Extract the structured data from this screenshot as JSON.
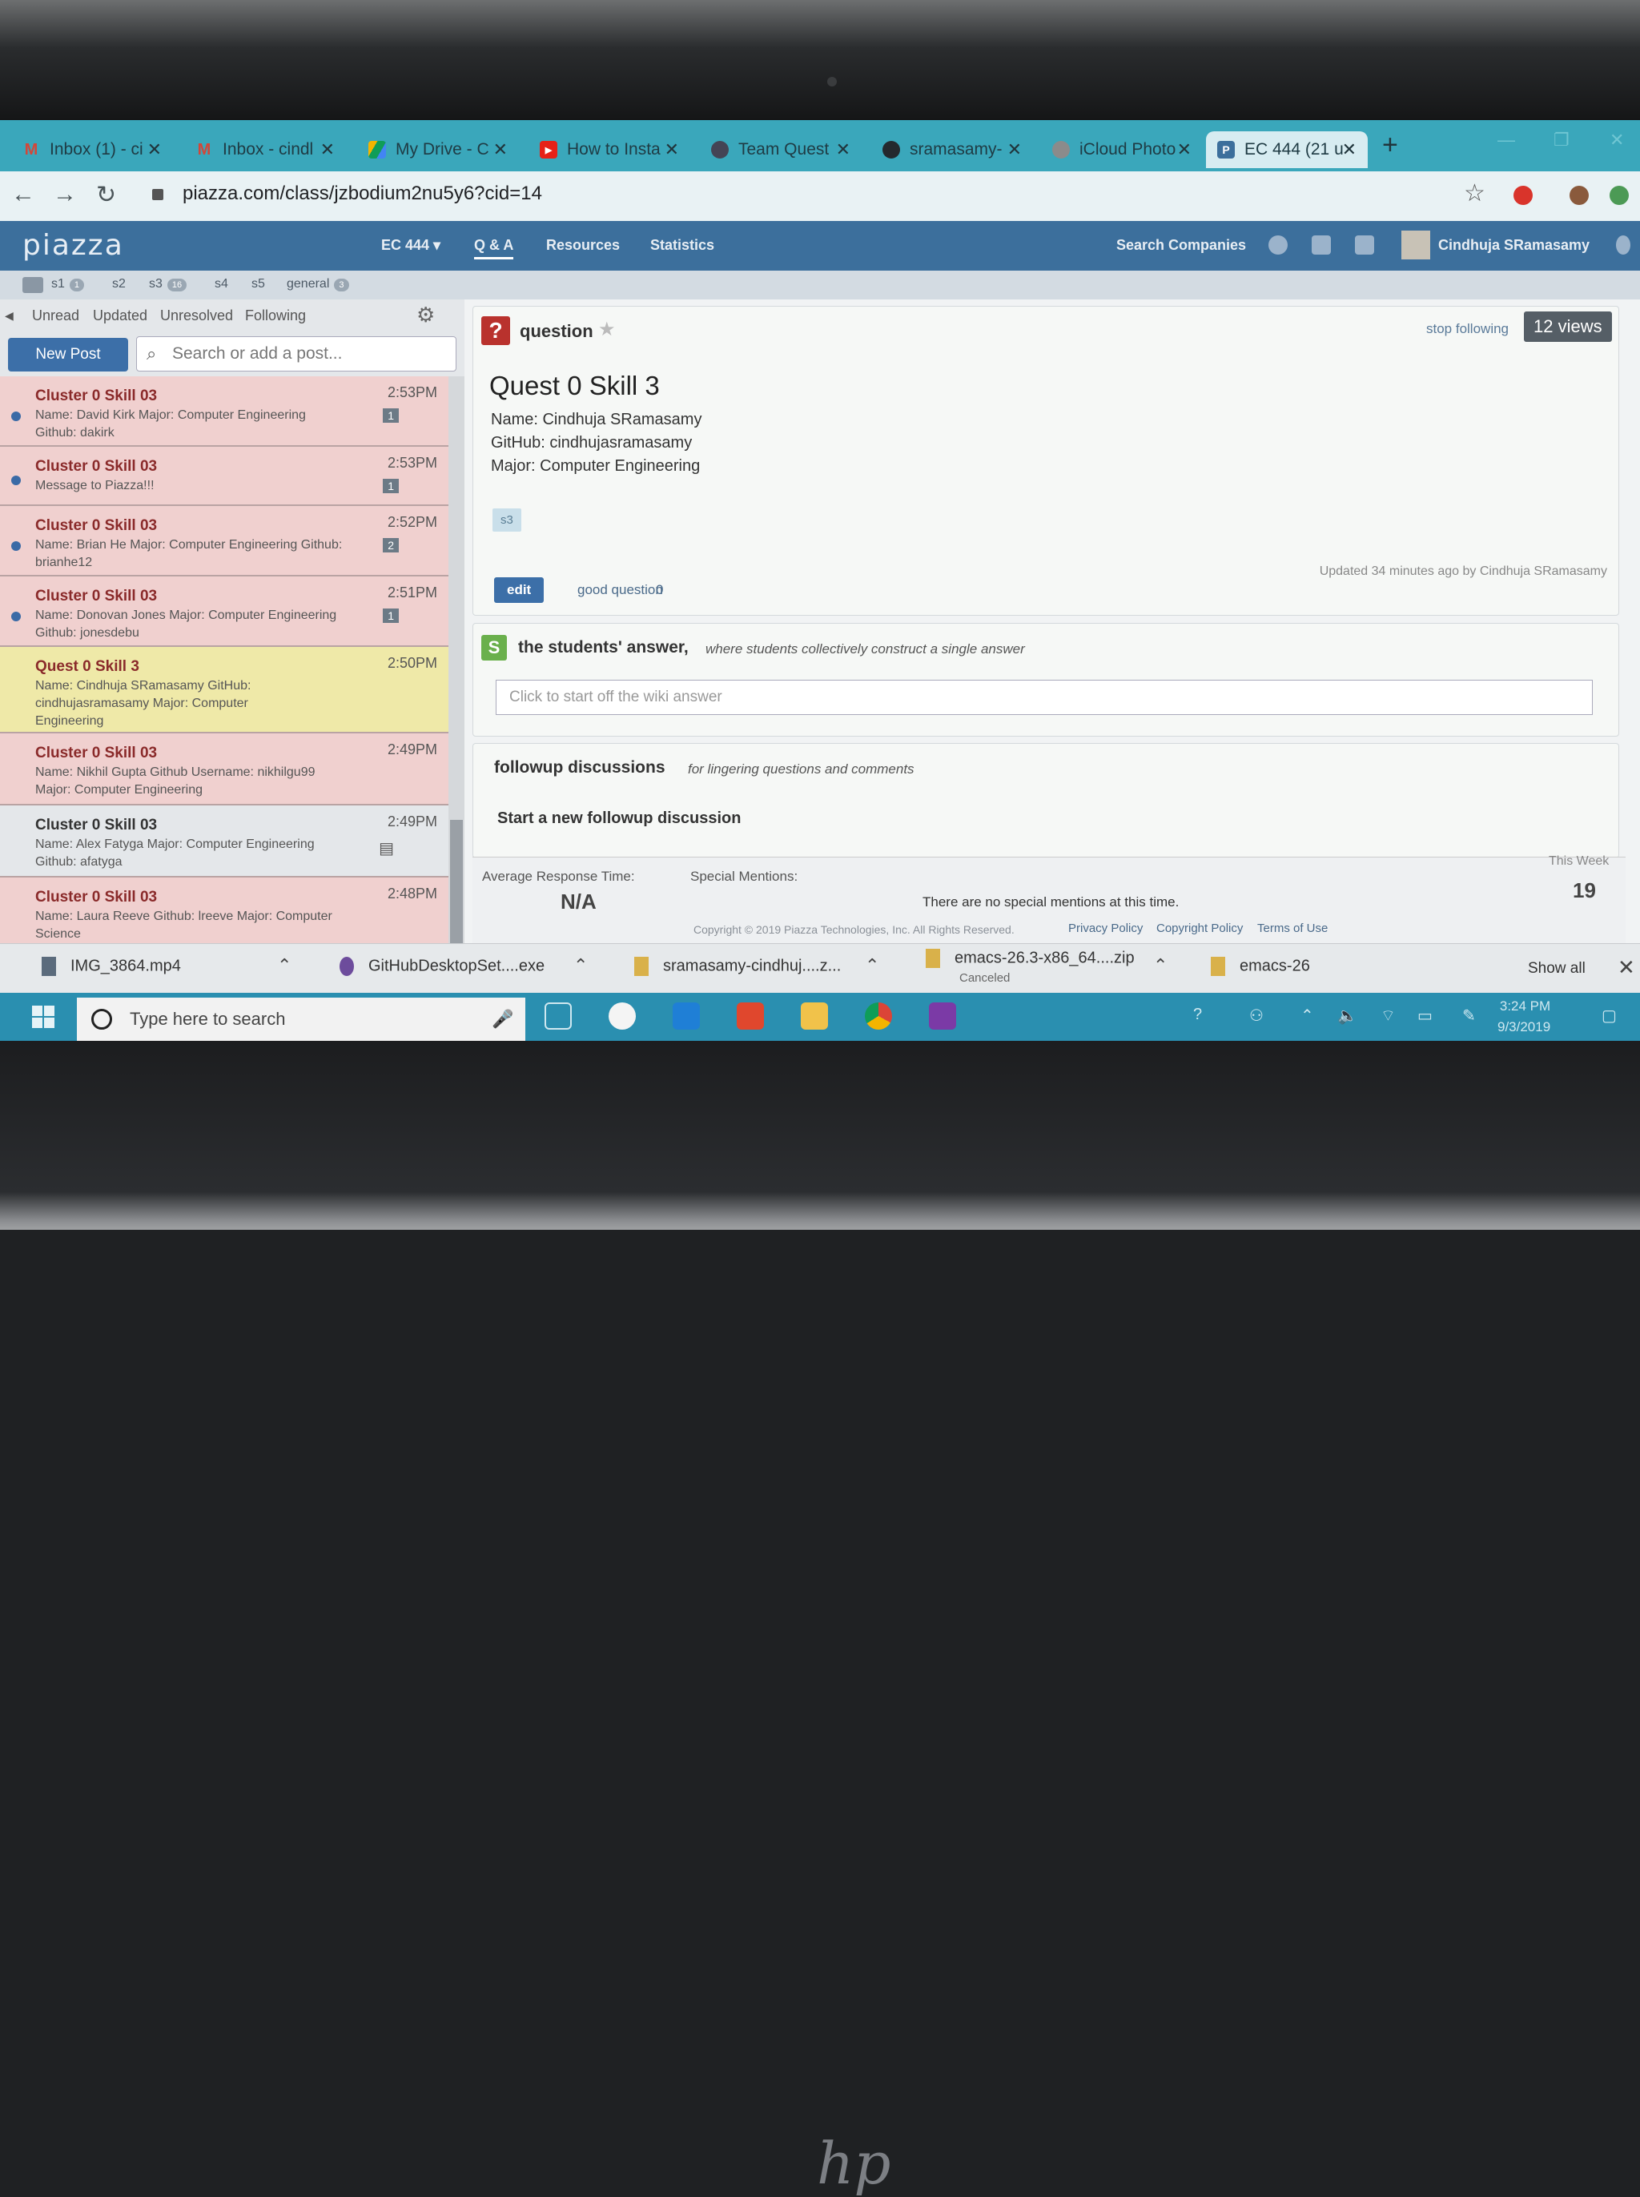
{
  "browser": {
    "tabs": [
      {
        "title": "Inbox (1) - ci",
        "icon": "gmail-icon"
      },
      {
        "title": "Inbox - cindl",
        "icon": "gmail-icon"
      },
      {
        "title": "My Drive - C",
        "icon": "drive-icon"
      },
      {
        "title": "How to Insta",
        "icon": "youtube-icon"
      },
      {
        "title": "Team Quest",
        "icon": "globe-icon"
      },
      {
        "title": "sramasamy-",
        "icon": "github-icon"
      },
      {
        "title": "iCloud Photo",
        "icon": "apple-icon"
      },
      {
        "title": "EC 444 (21 u",
        "icon": "piazza-icon"
      }
    ],
    "url": "piazza.com/class/jzbodium2nu5y6?cid=14"
  },
  "piazza": {
    "logo": "piazza",
    "nav": {
      "course": "EC 444 ▾",
      "qa": "Q & A",
      "resources": "Resources",
      "statistics": "Statistics",
      "search_companies": "Search Companies",
      "user": "Cindhuja SRamasamy"
    },
    "folders": [
      {
        "name": "s1",
        "count": "1"
      },
      {
        "name": "s2",
        "count": ""
      },
      {
        "name": "s3",
        "count": "16"
      },
      {
        "name": "s4",
        "count": ""
      },
      {
        "name": "s5",
        "count": ""
      },
      {
        "name": "general",
        "count": "3"
      }
    ],
    "filters": [
      "Unread",
      "Updated",
      "Unresolved",
      "Following"
    ],
    "new_post": "New Post",
    "search_placeholder": "Search or add a post...",
    "posts": [
      {
        "title": "Cluster 0 Skill 03",
        "time": "2:53PM",
        "body": "Name: David Kirk Major: Computer Engineering Github: dakirk",
        "count": "1",
        "unread": true
      },
      {
        "title": "Cluster 0 Skill 03",
        "time": "2:53PM",
        "body": "Message to Piazza!!!",
        "count": "1",
        "unread": true
      },
      {
        "title": "Cluster 0 Skill 03",
        "time": "2:52PM",
        "body": "Name: Brian He Major: Computer Engineering Github: brianhe12",
        "count": "2",
        "unread": true
      },
      {
        "title": "Cluster 0 Skill 03",
        "time": "2:51PM",
        "body": "Name: Donovan Jones Major: Computer Engineering Github: jonesdebu",
        "count": "1",
        "unread": true
      },
      {
        "title": "Quest 0 Skill 3",
        "time": "2:50PM",
        "body": "Name: Cindhuja SRamasamy GitHub: cindhujasramasamy Major: Computer Engineering",
        "count": "",
        "unread": false
      },
      {
        "title": "Cluster 0 Skill 03",
        "time": "2:49PM",
        "body": "Name: Nikhil Gupta Github Username: nikhilgu99 Major: Computer Engineering",
        "count": "",
        "unread": false
      },
      {
        "title": "Cluster 0 Skill 03",
        "time": "2:49PM",
        "body": "Name: Alex Fatyga Major: Computer Engineering Github: afatyga",
        "count": "",
        "unread": false
      },
      {
        "title": "Cluster 0 Skill 03",
        "time": "2:48PM",
        "body": "Name: Laura Reeve Github: lreeve Major: Computer Science",
        "count": "",
        "unread": false
      }
    ],
    "question": {
      "type": "question",
      "stop_following": "stop following",
      "views": "12 views",
      "title": "Quest 0 Skill 3",
      "lines": [
        "Name: Cindhuja SRamasamy",
        "GitHub: cindhujasramasamy",
        "Major: Computer Engineering"
      ],
      "tag": "s3",
      "edit": "edit",
      "good_question": "good question",
      "good_count": "0",
      "updated": "Updated 34 minutes ago by Cindhuja SRamasamy"
    },
    "students_answer": {
      "icon": "S",
      "heading": "the students' answer,",
      "subheading": "where students collectively construct a single answer",
      "placeholder": "Click to start off the wiki answer"
    },
    "followup": {
      "heading": "followup discussions",
      "subheading": "for lingering questions and comments",
      "start": "Start a new followup discussion"
    },
    "stats": {
      "avg_label": "Average Response Time:",
      "avg_value": "N/A",
      "mentions_label": "Special Mentions:",
      "mentions_value": "There are no special mentions at this time.",
      "week_label": "This Week",
      "week_value": "19"
    },
    "footer": {
      "copyright": "Copyright © 2019 Piazza Technologies, Inc. All Rights Reserved.",
      "privacy": "Privacy Policy",
      "copyright_policy": "Copyright Policy",
      "terms": "Terms of Use"
    }
  },
  "downloads": {
    "items": [
      {
        "name": "IMG_3864.mp4",
        "sub": ""
      },
      {
        "name": "GitHubDesktopSet....exe",
        "sub": ""
      },
      {
        "name": "sramasamy-cindhuj....z...",
        "sub": ""
      },
      {
        "name": "emacs-26.3-x86_64....zip",
        "sub": "Canceled"
      },
      {
        "name": "emacs-26",
        "sub": ""
      }
    ],
    "show_all": "Show all"
  },
  "taskbar": {
    "search_placeholder": "Type here to search",
    "time": "3:24 PM",
    "date": "9/3/2019"
  },
  "colors": {
    "tabstrip": "#3aa7bb",
    "piazza_nav": "#3c6f9c",
    "unread_post_bg": "#f0d0cf",
    "selected_post_bg": "#efe9a8",
    "taskbar": "#2a8fb0"
  }
}
